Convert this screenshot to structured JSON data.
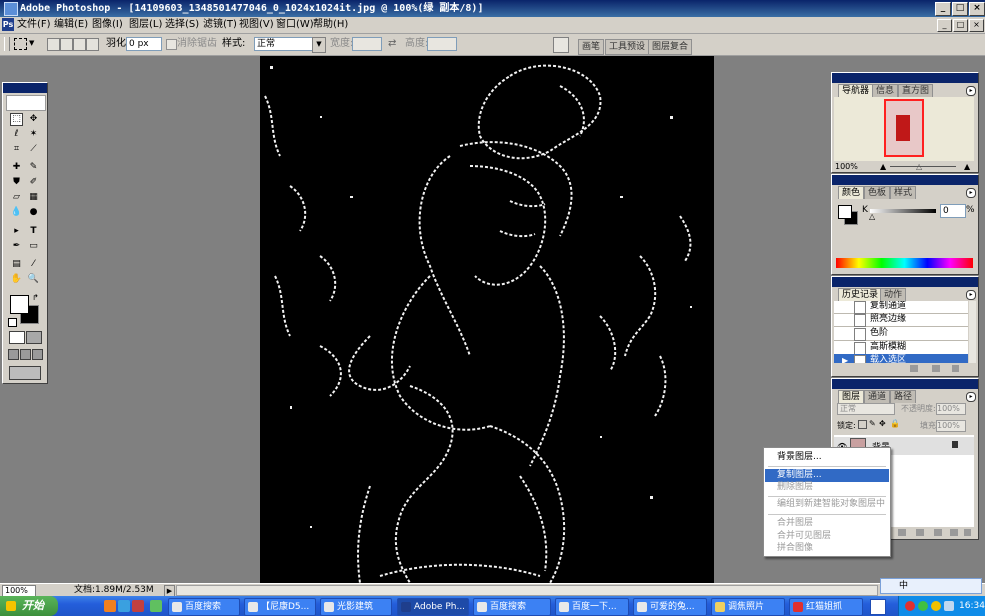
{
  "window": {
    "app_title": "Adobe Photoshop - [14109603_1348501477046_0_1024x1024it.jpg @ 100%(绿 副本/8)]",
    "buttons": [
      "_",
      "□",
      "×"
    ]
  },
  "menubar": {
    "items": [
      "文件(F)",
      "编辑(E)",
      "图像(I)",
      "图层(L)",
      "选择(S)",
      "滤镜(T)",
      "视图(V)",
      "窗口(W)",
      "帮助(H)"
    ],
    "doc_buttons": [
      "_",
      "□",
      "×"
    ]
  },
  "options": {
    "feather_label": "羽化:",
    "feather_value": "0 px",
    "antialias_label": "消除锯齿",
    "style_label": "样式:",
    "style_value": "正常",
    "width_label": "宽度:",
    "height_label": "高度:",
    "palette_tabs": [
      "画笔",
      "工具预设",
      "图层复合"
    ]
  },
  "navigator": {
    "tabs": [
      "导航器",
      "信息",
      "直方图"
    ],
    "zoom": "100%"
  },
  "color": {
    "tabs": [
      "颜色",
      "色板",
      "样式"
    ],
    "channel_label": "K",
    "value": "0",
    "unit": "%"
  },
  "history": {
    "tabs": [
      "历史记录",
      "动作"
    ],
    "items": [
      "复制通道",
      "照亮边缘",
      "色阶",
      "高斯模糊",
      "载入选区"
    ],
    "selected_index": 4
  },
  "layers": {
    "tabs": [
      "图层",
      "通道",
      "路径"
    ],
    "blend_mode": "正常",
    "opacity_label": "不透明度:",
    "opacity_value": "100%",
    "lock_label": "锁定:",
    "fill_label": "填充:",
    "fill_value": "100%",
    "layer_name": "背景"
  },
  "context_menu": {
    "items": [
      {
        "label": "背景图层...",
        "enabled": true
      },
      {
        "label": "复制图层...",
        "enabled": true,
        "highlighted": true
      },
      {
        "label": "删除图层",
        "enabled": false
      },
      {
        "label": "编组到新建智能对象图层中",
        "enabled": false
      },
      {
        "label": "合并图层",
        "enabled": false
      },
      {
        "label": "合并可见图层",
        "enabled": false
      },
      {
        "label": "拼合图像",
        "enabled": false
      }
    ]
  },
  "status": {
    "zoom": "100%",
    "doc_info": "文档:1.89M/2.53M"
  },
  "taskbar": {
    "start_label": "开始",
    "tasks": [
      "百度搜索",
      "【尼康D5...",
      "光影建筑",
      "Adobe Ph...",
      "百度搜索",
      "百度一下...",
      "可爱的兔...",
      "调焦照片",
      "红猫姐抓"
    ],
    "active_index": 3,
    "clock": "16:34",
    "ime_label": "中"
  },
  "colors": {
    "title_bar": "#0a246a",
    "selection": "#316ac5",
    "taskbar": "#245edb",
    "start": "#3c8f3c"
  }
}
